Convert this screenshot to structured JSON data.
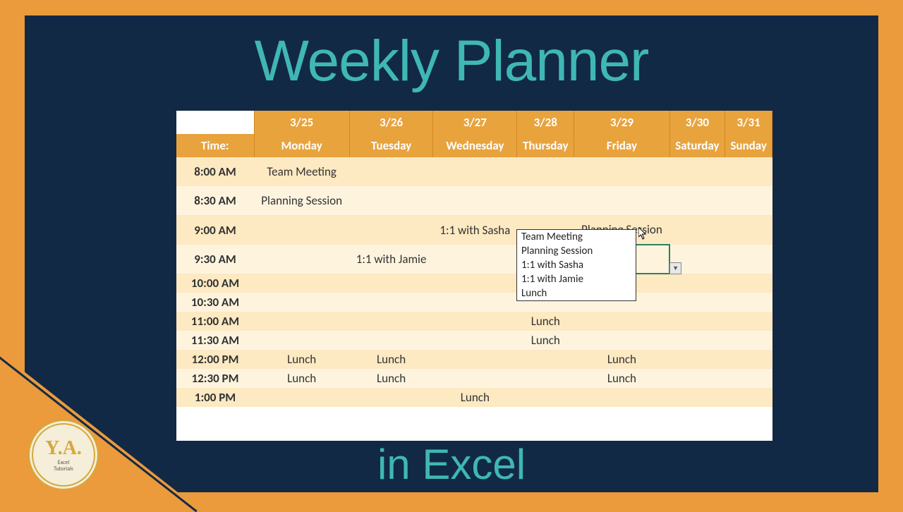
{
  "title_top": "Weekly Planner",
  "title_bottom": "in Excel",
  "logo": {
    "initials": "Y.A.",
    "line1": "Excel",
    "line2": "Tutorials"
  },
  "header": {
    "time_label": "Time:",
    "dates": [
      "3/25",
      "3/26",
      "3/27",
      "3/28",
      "3/29",
      "3/30",
      "3/31"
    ],
    "days": [
      "Monday",
      "Tuesday",
      "Wednesday",
      "Thursday",
      "Friday",
      "Saturday",
      "Sunday"
    ]
  },
  "rows": [
    {
      "time": "8:00 AM",
      "cells": [
        "Team Meeting",
        "",
        "",
        "",
        "",
        "",
        ""
      ]
    },
    {
      "time": "8:30 AM",
      "cells": [
        "Planning Session",
        "",
        "",
        "",
        "",
        "",
        ""
      ]
    },
    {
      "time": "9:00 AM",
      "cells": [
        "",
        "",
        "1:1 with Sasha",
        "",
        "Planning Session",
        "",
        ""
      ]
    },
    {
      "time": "9:30 AM",
      "cells": [
        "",
        "1:1 with Jamie",
        "",
        "",
        "",
        "",
        ""
      ]
    },
    {
      "time": "10:00 AM",
      "cells": [
        "",
        "",
        "",
        "",
        "",
        "",
        ""
      ]
    },
    {
      "time": "10:30 AM",
      "cells": [
        "",
        "",
        "",
        "",
        "",
        "",
        ""
      ]
    },
    {
      "time": "11:00 AM",
      "cells": [
        "",
        "",
        "",
        "Lunch",
        "",
        "",
        ""
      ]
    },
    {
      "time": "11:30 AM",
      "cells": [
        "",
        "",
        "",
        "Lunch",
        "",
        "",
        ""
      ]
    },
    {
      "time": "12:00 PM",
      "cells": [
        "Lunch",
        "Lunch",
        "",
        "",
        "Lunch",
        "",
        ""
      ]
    },
    {
      "time": "12:30 PM",
      "cells": [
        "Lunch",
        "Lunch",
        "",
        "",
        "Lunch",
        "",
        ""
      ]
    },
    {
      "time": "1:00 PM",
      "cells": [
        "",
        "",
        "Lunch",
        "",
        "",
        "",
        ""
      ]
    }
  ],
  "dropdown": {
    "items": [
      "Team Meeting",
      "Planning Session",
      "1:1 with Sasha",
      "1:1 with Jamie",
      "Lunch"
    ]
  }
}
